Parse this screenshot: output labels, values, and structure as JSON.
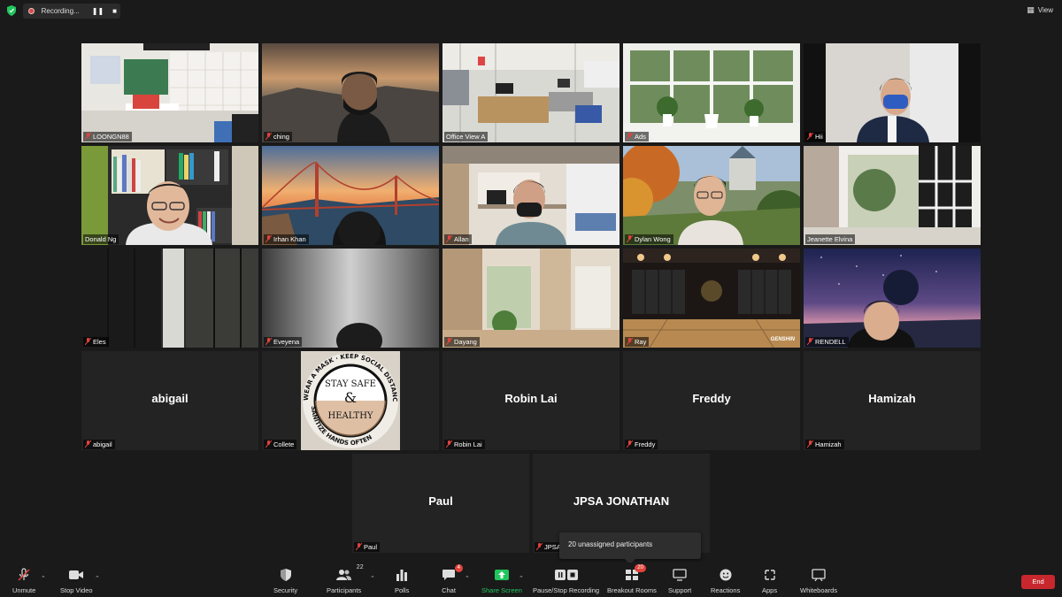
{
  "topbar": {
    "recording_label": "Recording...",
    "view_label": "View"
  },
  "tiles": {
    "loongn": "LOONGN88",
    "ching": "ching",
    "office": "Office View A",
    "ads": "Ads",
    "hii": "Hii",
    "donald": "Donald Ng",
    "irhan": "Irhan Khan",
    "allan": "Allan",
    "dylan": "Dylan Wong",
    "jeanette": "Jeanette Elvina",
    "eles": "Eles",
    "eveyena": "Eveyena",
    "dayang": "Dayang",
    "ray": "Ray",
    "rendell": "RENDELL",
    "abigail": "abigail",
    "collete": "Collete",
    "robin": "Robin Lai",
    "freddy": "Freddy",
    "hamizah": "Hamizah",
    "paul": "Paul",
    "jpsa": "JPSA JONATHAN",
    "jpsa_tag": "JPSA"
  },
  "game_logo": "GENSHIN",
  "avatar_text": {
    "line1": "STAY SAFE",
    "amp": "&",
    "line2": "HEALTHY",
    "ring_top": "WEAR A MASK · KEEP SOCIAL DISTANCE ·",
    "ring_bottom": "SANITIZE HANDS OFTEN"
  },
  "tooltip": "20 unassigned participants",
  "toolbar": {
    "unmute": "Unmute",
    "stop_video": "Stop Video",
    "security": "Security",
    "participants": "Participants",
    "participants_count": "22",
    "polls": "Polls",
    "chat": "Chat",
    "chat_badge": "4",
    "share": "Share Screen",
    "pause": "Pause/Stop Recording",
    "breakout": "Breakout Rooms",
    "breakout_badge": "20",
    "support": "Support",
    "reactions": "Reactions",
    "apps": "Apps",
    "whiteboards": "Whiteboards",
    "end": "End"
  },
  "colors": {
    "active_speaker": "#c9e04a",
    "end_button": "#c8282d",
    "share_green": "#22c55e",
    "muted_red": "#e0433c"
  }
}
